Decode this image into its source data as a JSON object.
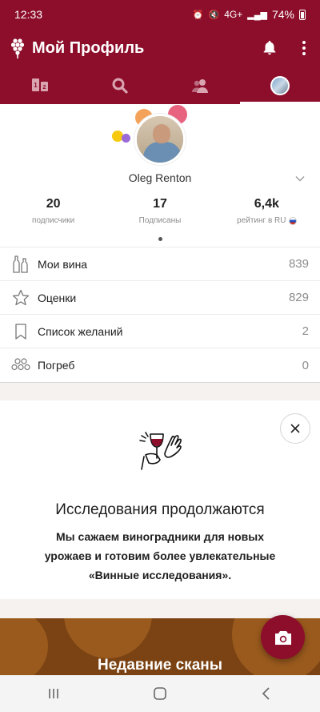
{
  "status_bar": {
    "time": "12:33",
    "network": "4G+",
    "battery": "74%"
  },
  "app_bar": {
    "title": "Мой Профиль",
    "icons": [
      "vivino-logo-icon",
      "bell-icon",
      "more-vert-icon"
    ]
  },
  "tabs": [
    {
      "name": "rankings",
      "icon": "ranking-icon"
    },
    {
      "name": "search",
      "icon": "search-icon"
    },
    {
      "name": "friends",
      "icon": "friends-icon"
    },
    {
      "name": "profile",
      "icon": "profile-avatar-icon",
      "active": true
    }
  ],
  "profile": {
    "name": "Oleg Renton",
    "stats": [
      {
        "value": "20",
        "label": "подписчики"
      },
      {
        "value": "17",
        "label": "Подписаны"
      },
      {
        "value": "6,4k",
        "label": "рейтинг в RU"
      }
    ]
  },
  "menu": [
    {
      "label": "Мои вина",
      "count": "839",
      "icon": "bottles-icon"
    },
    {
      "label": "Оценки",
      "count": "829",
      "icon": "star-icon"
    },
    {
      "label": "Список желаний",
      "count": "2",
      "icon": "bookmark-icon"
    },
    {
      "label": "Погреб",
      "count": "0",
      "icon": "cellar-icon"
    }
  ],
  "research_card": {
    "title": "Исследования продолжаются",
    "text": "Мы сажаем виноградники для новых урожаев и готовим более увлекательные «Винные исследования»."
  },
  "recent_scans": {
    "title": "Недавние сканы"
  },
  "colors": {
    "brand": "#8c0e2b",
    "scans_bg": "#7b4313",
    "dot_orange": "#f4a259",
    "dot_pink": "#e8637f",
    "dot_yellow": "#f6c90e",
    "dot_purple": "#9a6ad6"
  }
}
